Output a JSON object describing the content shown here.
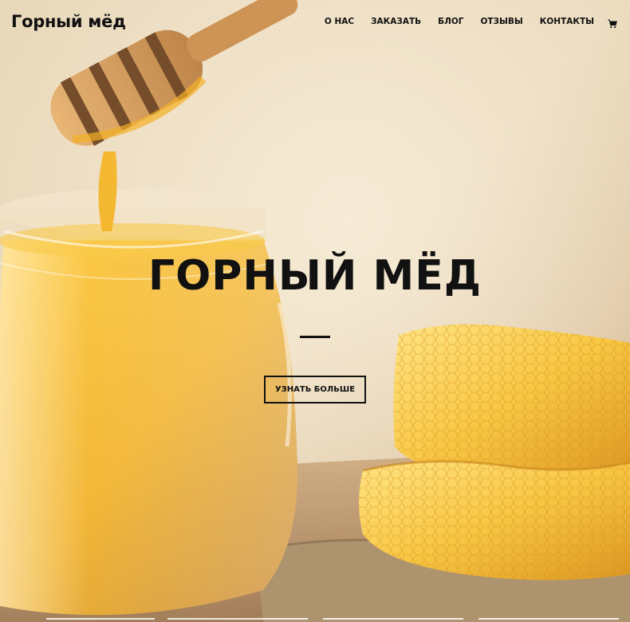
{
  "header": {
    "logo": "Горный мёд",
    "nav": [
      {
        "label": "О НАС"
      },
      {
        "label": "ЗАКАЗАТЬ"
      },
      {
        "label": "БЛОГ"
      },
      {
        "label": "ОТЗЫВЫ"
      },
      {
        "label": "КОНТАКТЫ"
      }
    ],
    "cart_icon": "cart-icon"
  },
  "hero": {
    "title": "ГОРНЫЙ МЁД",
    "button_label": "УЗНАТЬ БОЛЬШЕ",
    "background": "honey-jar-dipper-honeycomb-photo"
  },
  "colors": {
    "text": "#111111",
    "honey": "#e8a010",
    "background": "#d9c3a0"
  }
}
